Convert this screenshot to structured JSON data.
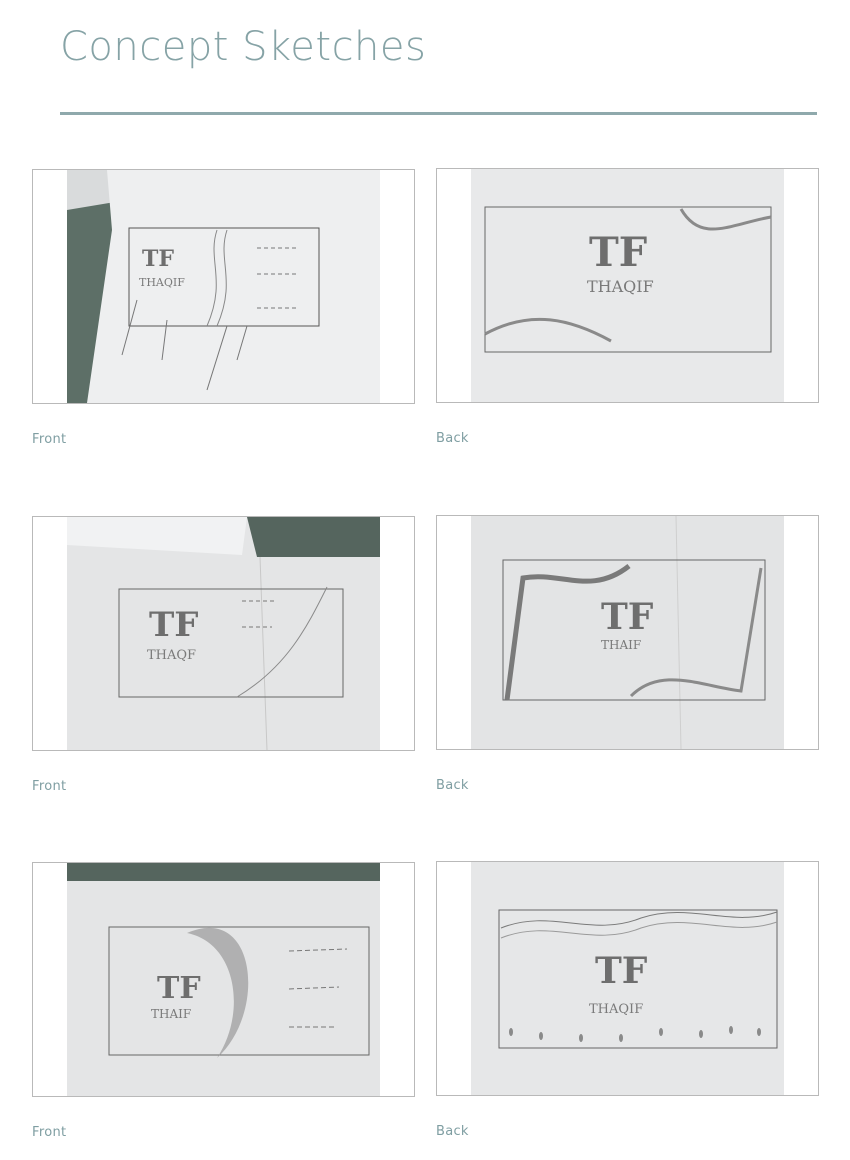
{
  "page": {
    "title": "Concept Sketches"
  },
  "sketches": [
    {
      "caption": "Front",
      "sketch_text": "TF",
      "sketch_name": "THAQIF"
    },
    {
      "caption": "Back",
      "sketch_text": "TF",
      "sketch_name": "THAQIF"
    },
    {
      "caption": "Front",
      "sketch_text": "TF",
      "sketch_name": "THAQF"
    },
    {
      "caption": "Back",
      "sketch_text": "TF",
      "sketch_name": "THAIF"
    },
    {
      "caption": "Front",
      "sketch_text": "TF",
      "sketch_name": "THAIF"
    },
    {
      "caption": "Back",
      "sketch_text": "TF",
      "sketch_name": "THAQIF"
    }
  ]
}
